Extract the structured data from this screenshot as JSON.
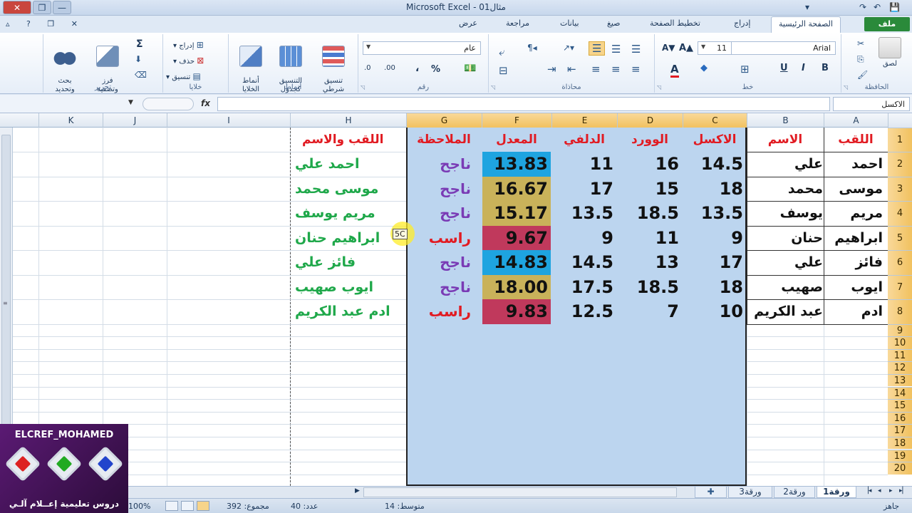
{
  "window": {
    "title": "Microsoft Excel - مثال01",
    "controls": {
      "close": "✕",
      "maximize": "❐",
      "minimize": "—"
    },
    "qat": [
      "💾",
      "↶",
      "↷",
      "▾"
    ]
  },
  "tabs": [
    "الصفحة الرئيسية",
    "إدراج",
    "تخطيط الصفحة",
    "صيغ",
    "بيانات",
    "مراجعة",
    "عرض"
  ],
  "file_tab": "ملف",
  "ribbon": {
    "clipboard": {
      "label": "الحافظة",
      "paste": "لصق"
    },
    "font": {
      "label": "خط",
      "name": "Arial",
      "size": "11",
      "bold": "B",
      "italic": "I",
      "underline": "U",
      "grow": "A▲",
      "shrink": "A▼",
      "font_color": "A",
      "fill_color": "◆"
    },
    "alignment": {
      "label": "محاذاة"
    },
    "number": {
      "label": "رقم",
      "format": "عام",
      "percent": "%",
      "comma": "،",
      "inc_decimal": ".00",
      "dec_decimal": ".0"
    },
    "styles": {
      "label": "أنماط",
      "conditional": "تنسيق\nشرطي",
      "as_table": "التنسيق\nكجدول",
      "cell_styles": "أنماط\nالخلايا"
    },
    "cells": {
      "label": "خلايا",
      "insert": "إدراج",
      "delete": "حذف",
      "format": "تنسيق"
    },
    "editing": {
      "label": "تحرير",
      "sort": "فرز\nوتصفية",
      "find": "بحث\nوتحديد",
      "sum": "Σ"
    }
  },
  "formula_bar": {
    "name_box": "الاكسل",
    "fx": "fx",
    "value": ""
  },
  "columns": [
    "A",
    "B",
    "C",
    "D",
    "E",
    "F",
    "G",
    "H",
    "I",
    "J",
    "K"
  ],
  "selected_columns": [
    "C",
    "D",
    "E",
    "F",
    "G"
  ],
  "col_tooltip": "5C",
  "rows": [
    "1",
    "2",
    "3",
    "4",
    "5",
    "6",
    "7",
    "8",
    "9",
    "10",
    "11",
    "12",
    "13",
    "14",
    "15",
    "16",
    "17",
    "18",
    "19",
    "20"
  ],
  "headers": {
    "A": "اللقب",
    "B": "الاسم",
    "C": "الاكسل",
    "D": "الوورد",
    "E": "الدلفي",
    "F": "المعدل",
    "G": "الملاحظة",
    "H": "اللقب والاسم"
  },
  "records": [
    {
      "A": "احمد",
      "B": "علي",
      "C": "14.5",
      "D": "16",
      "E": "11",
      "F": "13.83",
      "G": "ناجح",
      "H": "احمد  علي"
    },
    {
      "A": "موسى",
      "B": "محمد",
      "C": "18",
      "D": "15",
      "E": "17",
      "F": "16.67",
      "G": "ناجح",
      "H": "موسى محمد"
    },
    {
      "A": "مريم",
      "B": "يوسف",
      "C": "13.5",
      "D": "18.5",
      "E": "13.5",
      "F": "15.17",
      "G": "ناجح",
      "H": "مريم  يوسف"
    },
    {
      "A": "ابراهيم",
      "B": "حنان",
      "C": "9",
      "D": "11",
      "E": "9",
      "F": "9.67",
      "G": "راسب",
      "H": "ابراهيم حنان"
    },
    {
      "A": "فائز",
      "B": "علي",
      "C": "17",
      "D": "13",
      "E": "14.5",
      "F": "14.83",
      "G": "ناجح",
      "H": "فائز  علي"
    },
    {
      "A": "ايوب",
      "B": "صهيب",
      "C": "18",
      "D": "18.5",
      "E": "17.5",
      "F": "18.00",
      "G": "ناجح",
      "H": "ايوب  صهيب"
    },
    {
      "A": "ادم",
      "B": "عبد الكريم",
      "C": "10",
      "D": "7",
      "E": "12.5",
      "F": "9.83",
      "G": "راسب",
      "H": "ادم عبد الكريم"
    }
  ],
  "colors": {
    "header_text": "#e11b22",
    "pass_text": "#7a3bb5",
    "fail_text": "#e11b22",
    "fullname_text": "#1fa84a",
    "avg_blue": "#1ea4e0",
    "avg_olive": "#c9b25a",
    "avg_red": "#c0395c",
    "selection": "#bcd5ef"
  },
  "avg_fill": [
    "blue",
    "olive",
    "olive",
    "red",
    "blue",
    "olive",
    "red"
  ],
  "sheets": {
    "tabs": [
      "ورقة1",
      "ورقة2",
      "ورقة3"
    ],
    "active": "ورقة1"
  },
  "status": {
    "ready": "جاهز",
    "average": "متوسط: 14",
    "count": "عدد: 40",
    "sum": "مجموع: 392",
    "zoom": "100%"
  },
  "logo": {
    "title": "ELCREF_MOHAMED",
    "subtitle": "دروس تعليمية إعــلام آلـي"
  }
}
